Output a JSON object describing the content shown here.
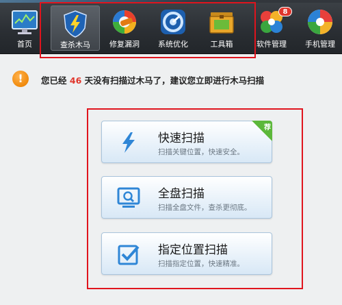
{
  "toolbar": {
    "items": [
      {
        "label": "首页",
        "icon": "monitor-chart-icon",
        "active": false
      },
      {
        "label": "查杀木马",
        "icon": "shield-lightning-icon",
        "active": true
      },
      {
        "label": "修复漏洞",
        "icon": "repair-ie-icon",
        "active": false
      },
      {
        "label": "系统优化",
        "icon": "speedometer-icon",
        "active": false
      },
      {
        "label": "工具箱",
        "icon": "toolbox-icon",
        "active": false
      },
      {
        "label": "软件管理",
        "icon": "colorful-petals-icon",
        "badge": "8",
        "active": false
      },
      {
        "label": "手机管理",
        "icon": "phone-swirl-icon",
        "active": false
      }
    ]
  },
  "notice": {
    "prefix": "您已经",
    "days": "46",
    "suffix": "天没有扫描过木马了，建议您立即进行木马扫描",
    "icon": "warning-icon"
  },
  "scan_options": [
    {
      "title": "快速扫描",
      "subtitle": "扫描关键位置，快速安全。",
      "icon": "lightning-icon",
      "recommended_label": "荐"
    },
    {
      "title": "全盘扫描",
      "subtitle": "扫描全盘文件，查杀更彻底。",
      "icon": "monitor-magnifier-icon"
    },
    {
      "title": "指定位置扫描",
      "subtitle": "扫描指定位置，快速精准。",
      "icon": "checkbox-icon"
    }
  ],
  "colors": {
    "highlight_box": "#e0141d",
    "days_number": "#e0362c",
    "recommended_flag": "#5cb83a"
  }
}
